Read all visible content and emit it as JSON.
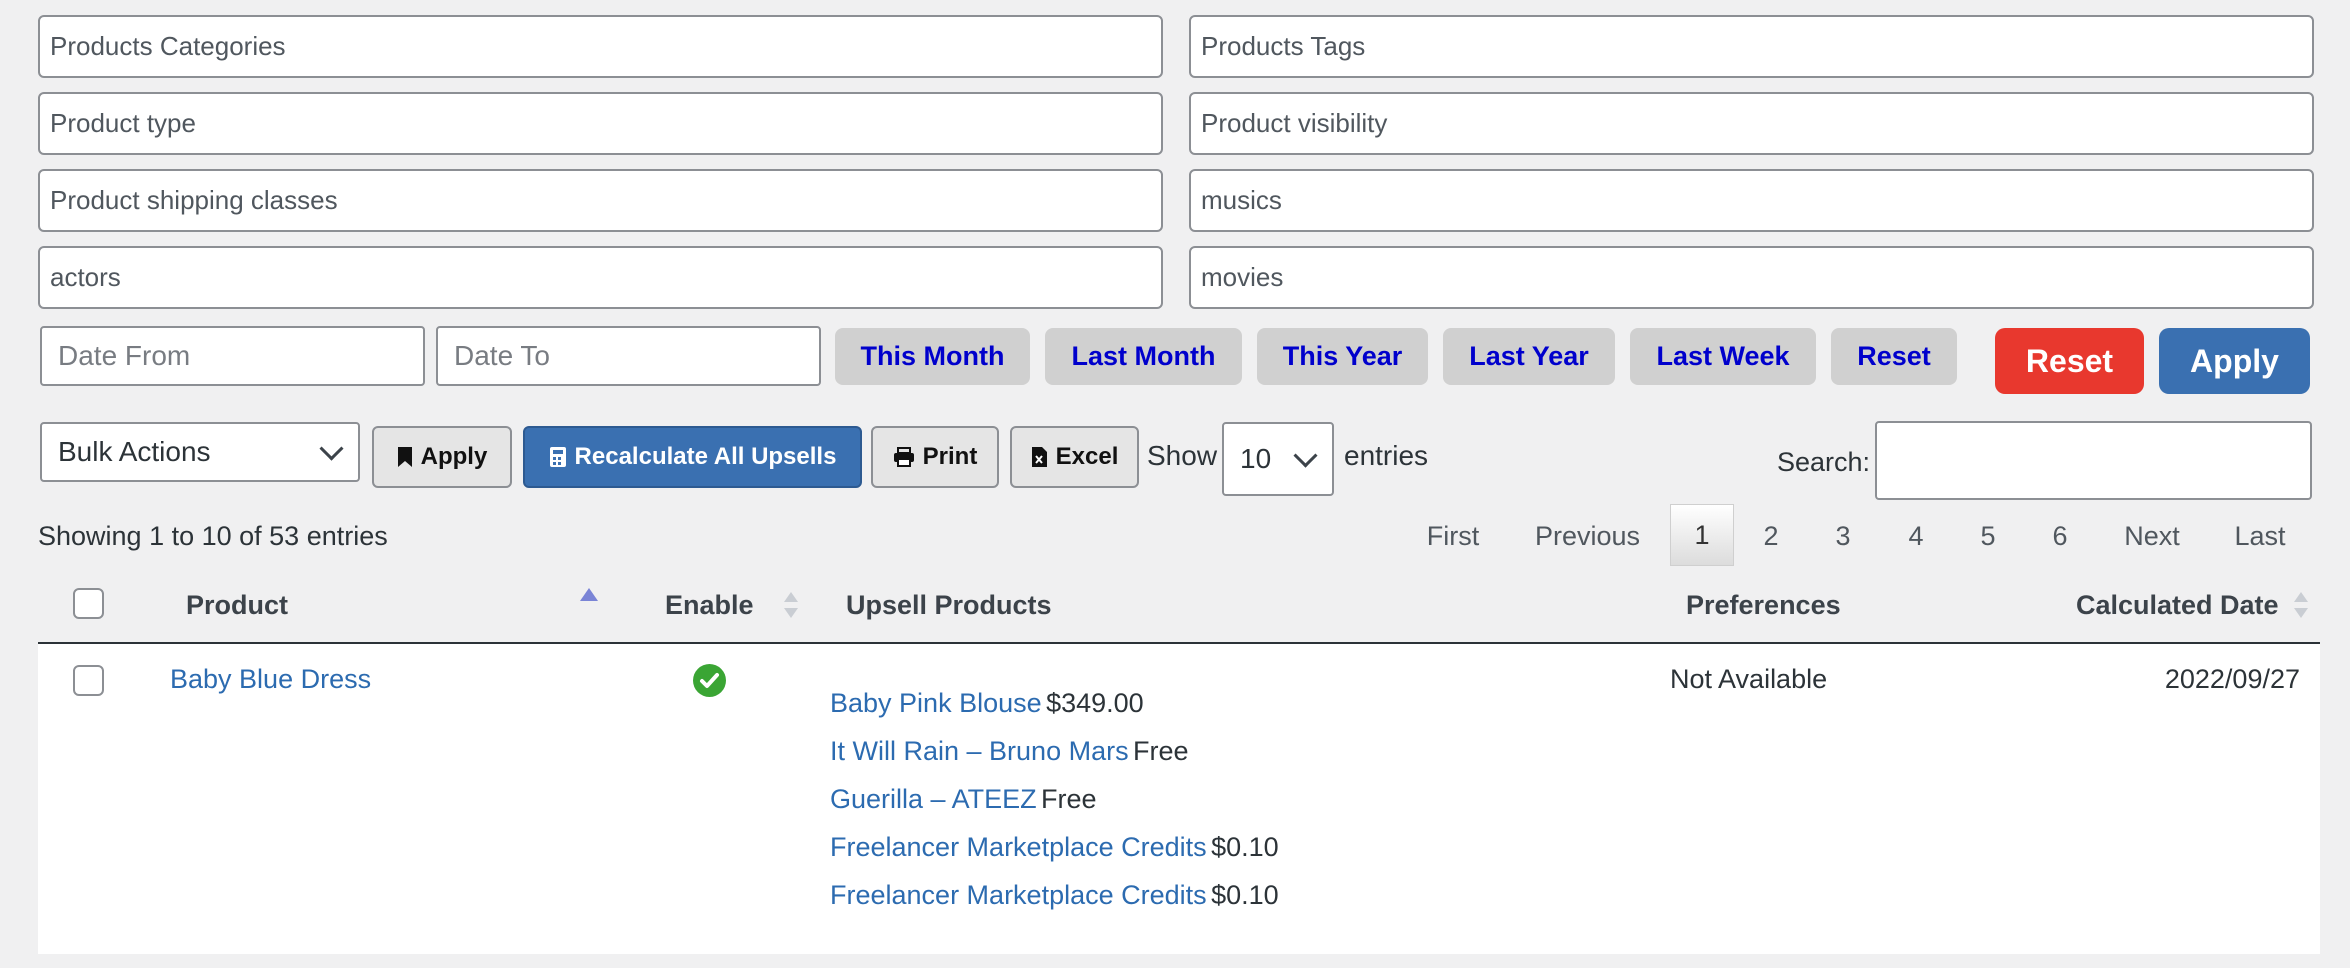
{
  "filters": {
    "left": [
      "Products Categories",
      "Product type",
      "Product shipping classes",
      "actors"
    ],
    "right": [
      "Products Tags",
      "Product visibility",
      "musics",
      "movies"
    ]
  },
  "date": {
    "from_placeholder": "Date From",
    "to_placeholder": "Date To",
    "ranges": [
      "This Month",
      "Last Month",
      "This Year",
      "Last Year",
      "Last Week",
      "Reset"
    ],
    "reset_label": "Reset",
    "apply_label": "Apply"
  },
  "toolbar": {
    "bulk_actions": "Bulk Actions",
    "apply_label": "Apply",
    "recalculate_label": "Recalculate All Upsells",
    "print_label": "Print",
    "excel_label": "Excel",
    "show_label": "Show",
    "entries_value": "10",
    "entries_label": "entries",
    "search_label": "Search:"
  },
  "info": "Showing 1 to 10 of 53 entries",
  "pagination": {
    "first": "First",
    "previous": "Previous",
    "pages": [
      "1",
      "2",
      "3",
      "4",
      "5",
      "6"
    ],
    "current": "1",
    "next": "Next",
    "last": "Last"
  },
  "table": {
    "headers": {
      "product": "Product",
      "enable": "Enable",
      "upsell": "Upsell Products",
      "preferences": "Preferences",
      "date": "Calculated Date"
    },
    "rows": [
      {
        "product": "Baby Blue Dress",
        "enabled": true,
        "upsells": [
          {
            "name": "Baby Pink Blouse",
            "price": "$349.00"
          },
          {
            "name": "It Will Rain – Bruno Mars",
            "price": "Free"
          },
          {
            "name": "Guerilla – ATEEZ",
            "price": "Free"
          },
          {
            "name": "Freelancer Marketplace Credits",
            "price": "$0.10"
          },
          {
            "name": "Freelancer Marketplace Credits",
            "price": "$0.10"
          }
        ],
        "preferences": "Not Available",
        "date": "2022/09/27"
      }
    ]
  },
  "colors": {
    "link": "#2c6bb0",
    "range_text": "#0000cc",
    "reset_red": "#e8382e",
    "apply_blue": "#3a70b1",
    "enabled_green": "#3aa534"
  }
}
